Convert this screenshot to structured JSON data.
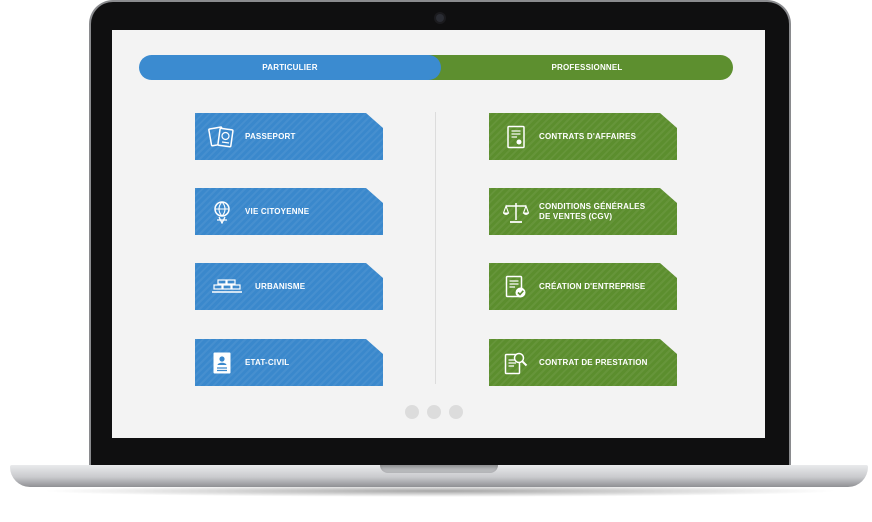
{
  "toggle": {
    "left_label": "PARTICULIER",
    "right_label": "PROFESSIONNEL"
  },
  "colors": {
    "blue": "#3a88cc",
    "green": "#5c8e2e",
    "screen_bg": "#f3f3f3"
  },
  "particulier": [
    {
      "label": "PASSEPORT",
      "icon": "passport-icon"
    },
    {
      "label": "VIE CITOYENNE",
      "icon": "citizen-globe-icon"
    },
    {
      "label": "URBANISME",
      "icon": "bricks-icon"
    },
    {
      "label": "ETAT-CIVIL",
      "icon": "id-document-icon"
    }
  ],
  "professionnel": [
    {
      "label": "CONTRATS D'AFFAIRES",
      "icon": "contract-icon"
    },
    {
      "label_line1": "CONDITIONS GÉNÉRALES",
      "label_line2": "DE VENTES (CGV)",
      "icon": "scales-icon"
    },
    {
      "label": "CRÉATION D'ENTREPRISE",
      "icon": "document-check-icon"
    },
    {
      "label": "CONTRAT DE PRESTATION",
      "icon": "document-search-icon"
    }
  ],
  "pagination": {
    "pages": 3
  }
}
